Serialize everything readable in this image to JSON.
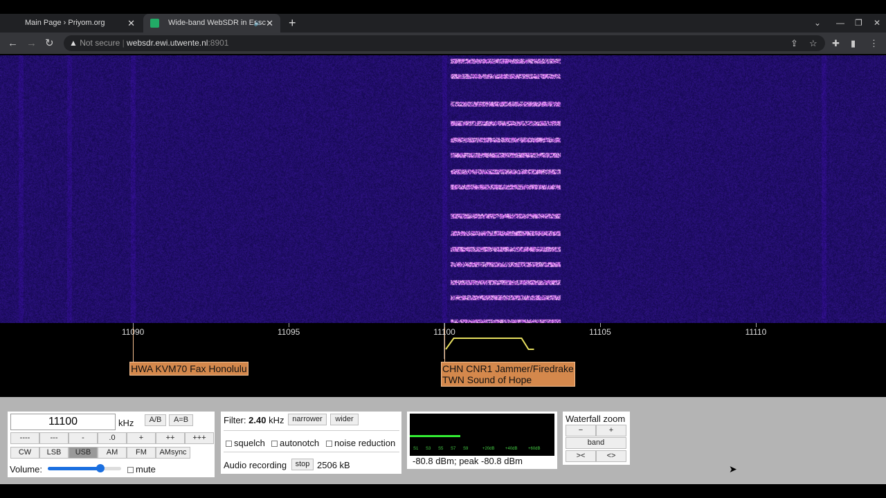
{
  "browser": {
    "tabs": [
      {
        "title": "Main Page › Priyom.org",
        "active": false
      },
      {
        "title": "Wide-band WebSDR in Ensc",
        "active": true,
        "audio": "speaker-icon"
      }
    ],
    "url_security": "Not secure",
    "url_host": "websdr.ewi.utwente.nl",
    "url_port": ":8901"
  },
  "scale": {
    "ticks": [
      11090,
      11095,
      11100,
      11105,
      11110
    ],
    "range_khz": [
      11085.73,
      11114.18
    ],
    "tuned_khz": 11100,
    "passband_khz": [
      0.3,
      2.7
    ]
  },
  "stations": [
    {
      "lines": [
        "HWA KVM70 Fax Honolulu"
      ],
      "freq_khz": 11090
    },
    {
      "lines": [
        "CHN CNR1 Jammer/Firedrake",
        "TWN Sound of Hope"
      ],
      "freq_khz": 11100
    }
  ],
  "freq": {
    "value": "11100",
    "unit": "kHz",
    "ab": "A/B",
    "aeqb": "A=B",
    "steps": [
      "----",
      "---",
      "-",
      ".0",
      "+",
      "++",
      "+++"
    ],
    "modes": [
      "CW",
      "LSB",
      "USB",
      "AM",
      "FM",
      "AMsync"
    ],
    "selected_mode": "USB",
    "volume_label": "Volume:",
    "volume": 0.72,
    "mute": "mute"
  },
  "filter": {
    "label": "Filter:",
    "value": "2.40",
    "unit": "kHz",
    "narrower": "narrower",
    "wider": "wider",
    "squelch": "squelch",
    "autonotch": "autonotch",
    "noise": "noise reduction",
    "rec_label": "Audio recording",
    "stop": "stop",
    "rec_size": "2506 kB"
  },
  "smeter": {
    "scale": [
      "S1",
      "S3",
      "S5",
      "S7",
      "S9",
      "+20dB",
      "+40dB",
      "+60dB"
    ],
    "level_fraction": 0.35,
    "text": "-80.8 dBm; peak  -80.8 dBm",
    "accent": "#33ee33"
  },
  "zoom": {
    "title": "Waterfall zoom",
    "minus": "−",
    "plus": "+",
    "band": "band",
    "narrow": "><",
    "wide": "<>"
  }
}
